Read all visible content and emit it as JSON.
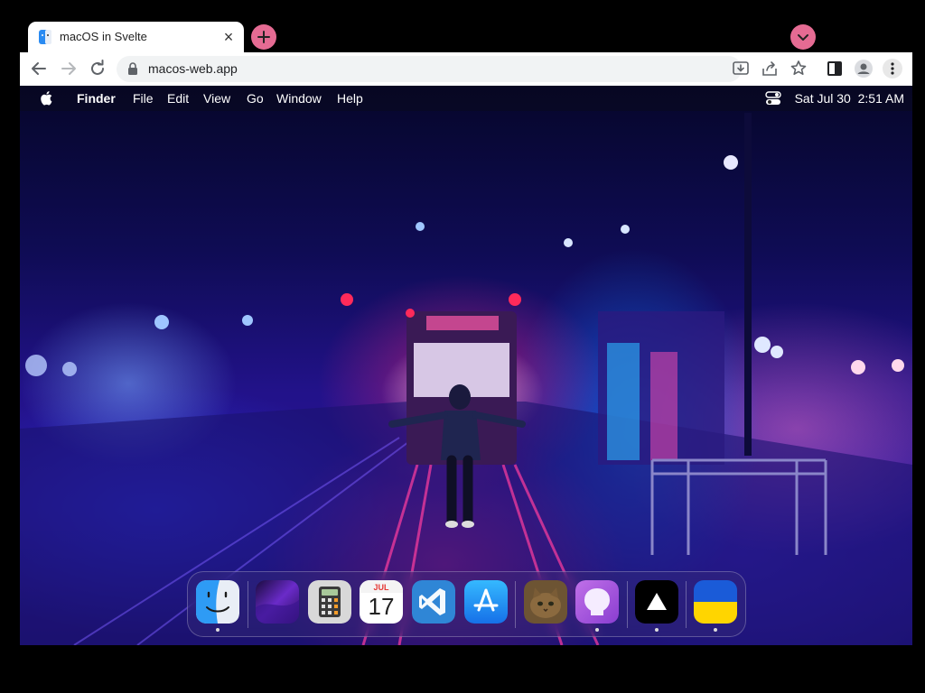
{
  "browser": {
    "tab_title": "macOS in Svelte",
    "url": "macos-web.app"
  },
  "menubar": {
    "app_name": "Finder",
    "items": [
      "File",
      "Edit",
      "View",
      "Go",
      "Window",
      "Help"
    ],
    "date": "Sat Jul 30",
    "time": "2:51 AM"
  },
  "dock": {
    "calendar_month": "JUL",
    "calendar_day": "17",
    "apps": [
      {
        "name": "finder-icon",
        "running": true
      },
      {
        "name": "wallpapers-icon",
        "running": false
      },
      {
        "name": "calculator-icon",
        "running": false
      },
      {
        "name": "calendar-icon",
        "running": false
      },
      {
        "name": "vscode-icon",
        "running": false
      },
      {
        "name": "app-store-icon",
        "running": false
      },
      {
        "name": "purrfect-cat-icon",
        "running": false
      },
      {
        "name": "github-icon",
        "running": true
      },
      {
        "name": "vercel-icon",
        "running": true
      },
      {
        "name": "ukraine-flag-icon",
        "running": true
      }
    ]
  },
  "colors": {
    "accent_pink": "#e56b93",
    "menubar_text": "#ffffff"
  }
}
